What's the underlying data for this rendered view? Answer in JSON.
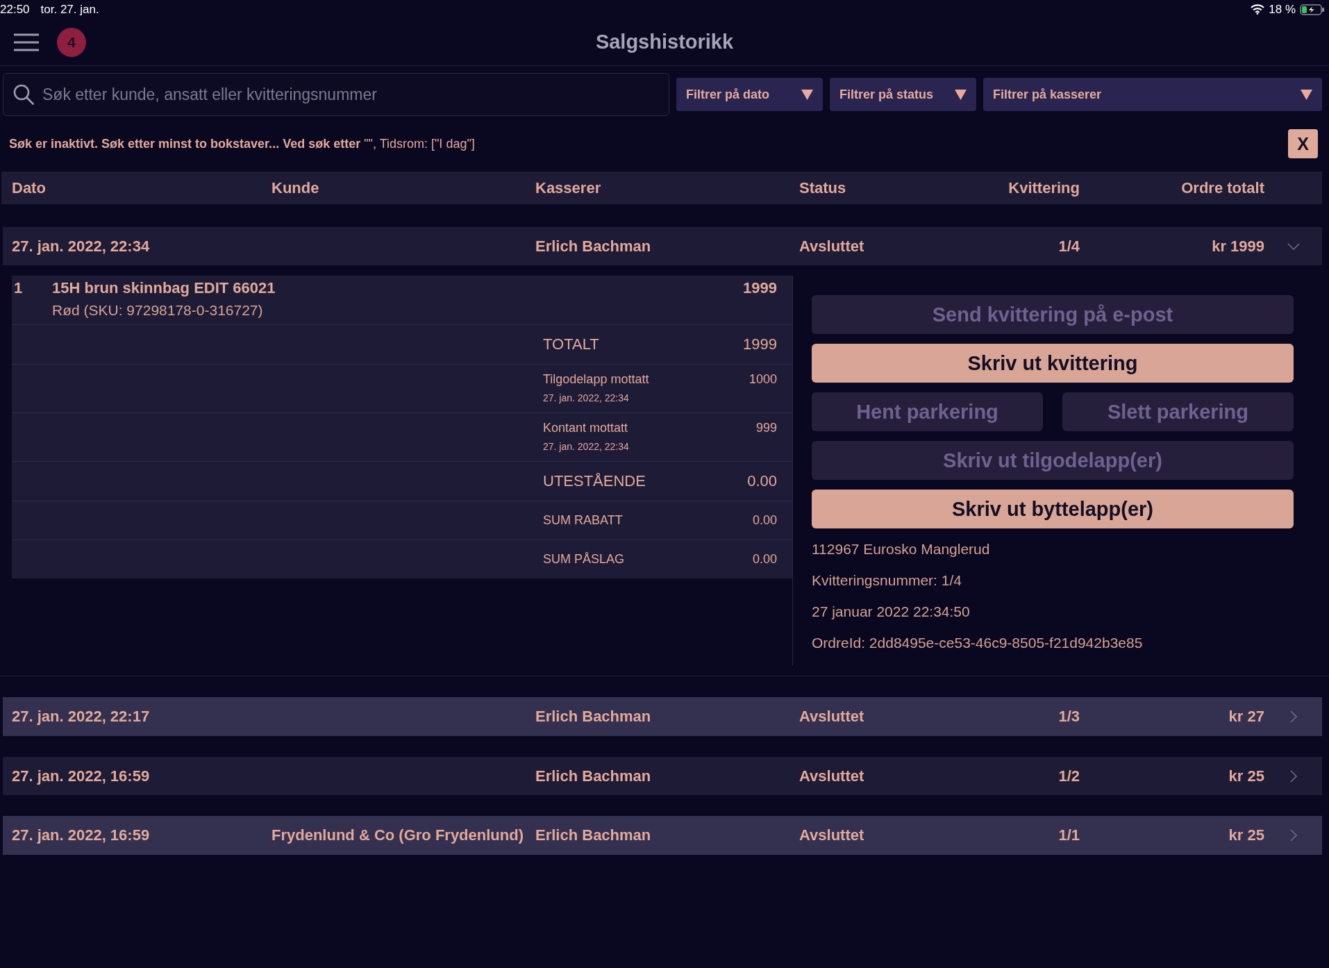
{
  "status_bar": {
    "time": "22:50",
    "date": "tor. 27. jan.",
    "battery": "18 %"
  },
  "header": {
    "badge": "4",
    "title": "Salgshistorikk"
  },
  "search": {
    "placeholder": "Søk etter kunde, ansatt eller kvitteringsnummer"
  },
  "filters": [
    {
      "label": "Filtrer på dato"
    },
    {
      "label": "Filtrer på status"
    },
    {
      "label": "Filtrer på kasserer"
    }
  ],
  "notice": {
    "text": "**Søk er inaktivt. Søk etter minst to bokstaver... Ved søk etter** \"\", Tidsrom: [\"I dag\"]",
    "close": "X"
  },
  "table": {
    "columns": [
      "Dato",
      "Kunde",
      "Kasserer",
      "Status",
      "Kvittering",
      "Ordre totalt"
    ],
    "rows": [
      {
        "date": "27. jan. 2022, 22:34",
        "cashier": "Erlich Bachman",
        "status": "Avsluttet",
        "receipt": "1/4",
        "total": "kr 1999",
        "expanded": true,
        "detail": {
          "lines": [
            {
              "qty": "1",
              "name": "15H brun skinnbag EDIT 66021",
              "variant": "Rød (SKU: 97298178-0-316727)",
              "price": "1999"
            }
          ],
          "summary": [
            {
              "kind": "total",
              "label": "TOTALT",
              "value": "1999"
            },
            {
              "kind": "payment",
              "label": "Tilgodelapp mottatt",
              "date": "27. jan. 2022, 22:34",
              "value": "1000"
            },
            {
              "kind": "payment",
              "label": "Kontant mottatt",
              "date": "27. jan. 2022, 22:34",
              "value": "999"
            },
            {
              "kind": "total",
              "label": "UTESTÅENDE",
              "value": "0.00"
            },
            {
              "kind": "sum",
              "label": "SUM RABATT",
              "value": "0.00"
            },
            {
              "kind": "sum",
              "label": "SUM PÅSLAG",
              "value": "0.00"
            }
          ],
          "action_rows": [
            {
              "buttons": [
                {
                  "label": "Send kvittering på e-post",
                  "disabled": true
                }
              ]
            },
            {
              "buttons": [
                {
                  "label": "Skriv ut kvittering",
                  "disabled": false
                }
              ]
            },
            {
              "buttons": [
                {
                  "label": "Hent parkering",
                  "disabled": true
                },
                {
                  "label": "Slett parkering",
                  "disabled": true
                }
              ]
            },
            {
              "buttons": [
                {
                  "label": "Skriv ut tilgodelapp(er)",
                  "disabled": true
                }
              ]
            },
            {
              "buttons": [
                {
                  "label": "Skriv ut byttelapp(er)",
                  "disabled": false
                }
              ]
            }
          ],
          "info": [
            "112967 Eurosko Manglerud",
            "Kvitteringsnummer: 1/4",
            "27 januar 2022 22:34:50",
            "OrdreId: 2dd8495e-ce53-46c9-8505-f21d942b3e85"
          ]
        }
      },
      {
        "date": "27. jan. 2022, 22:17",
        "cashier": "Erlich Bachman",
        "status": "Avsluttet",
        "receipt": "1/3",
        "total": "kr 27",
        "expanded": false
      },
      {
        "date": "27. jan. 2022, 16:59",
        "cashier": "Erlich Bachman",
        "status": "Avsluttet",
        "receipt": "1/2",
        "total": "kr 25",
        "expanded": false
      },
      {
        "date": "27. jan. 2022, 16:59",
        "customer": "Frydenlund & Co (Gro Frydenlund)",
        "cashier": "Erlich Bachman",
        "status": "Avsluttet",
        "receipt": "1/1",
        "total": "kr 25",
        "expanded": false
      }
    ]
  }
}
